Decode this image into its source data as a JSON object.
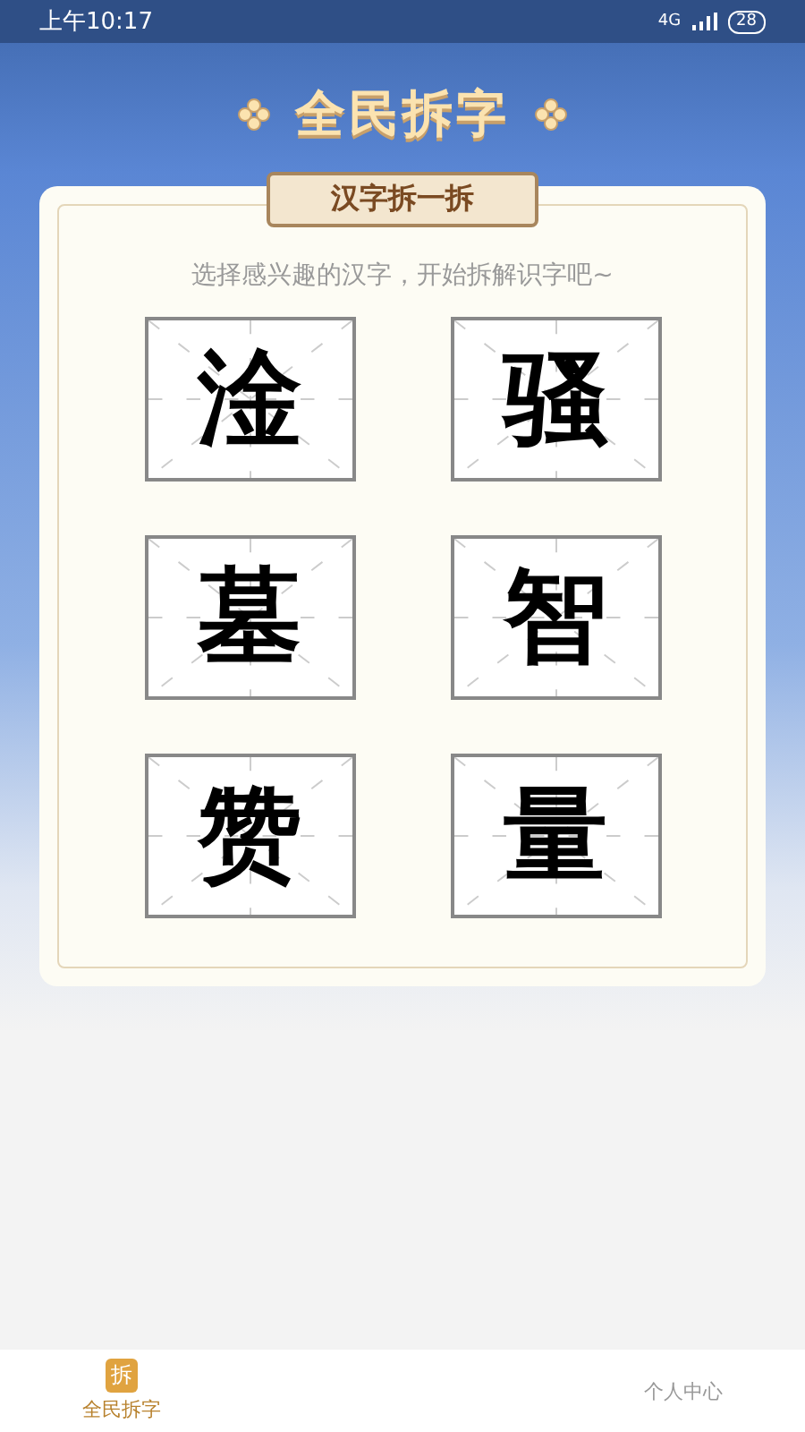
{
  "status_bar": {
    "time": "上午10:17",
    "network": "4G",
    "battery": "28"
  },
  "header": {
    "title": "全民拆字"
  },
  "card": {
    "title": "汉字拆一拆",
    "hint": "选择感兴趣的汉字，开始拆解识字吧~",
    "characters": [
      "淦",
      "骚",
      "墓",
      "智",
      "赞",
      "量"
    ]
  },
  "tab_bar": [
    {
      "label": "全民拆字",
      "icon": "拆",
      "selected": true
    },
    {
      "label": "个人中心",
      "selected": false
    }
  ]
}
